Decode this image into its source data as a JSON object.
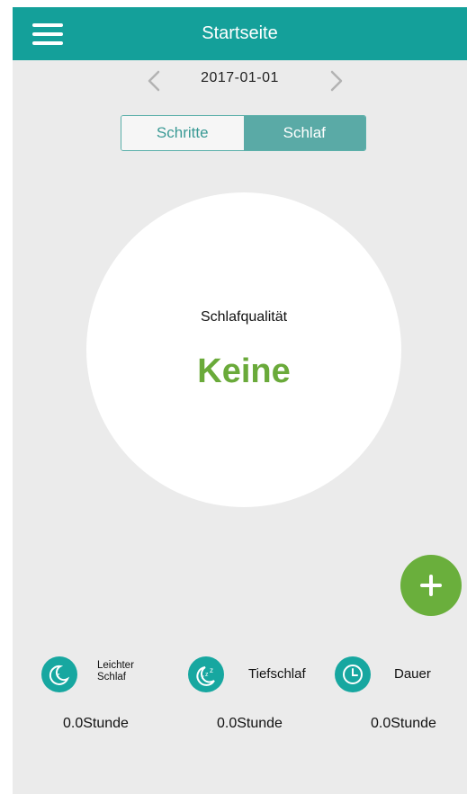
{
  "header": {
    "title": "Startseite",
    "menu_icon": "hamburger-menu-icon"
  },
  "date_nav": {
    "date": "2017-01-01",
    "prev_icon": "chevron-left-icon",
    "next_icon": "chevron-right-icon"
  },
  "mode_toggle": {
    "options": [
      "Schritte",
      "Schlaf"
    ],
    "selected": "Schlaf"
  },
  "sleep_quality": {
    "label": "Schlafqualität",
    "value": "Keine"
  },
  "add_button": {
    "icon": "plus-icon"
  },
  "stats": [
    {
      "label_line1": "Leichter",
      "label_line2": "Schlaf",
      "value": "0.0Stunde",
      "icon": "moon-icon"
    },
    {
      "label": "Tiefschlaf",
      "value": "0.0Stunde",
      "icon": "moon-zzz-icon"
    },
    {
      "label": "Dauer",
      "value": "0.0Stunde",
      "icon": "clock-icon"
    }
  ],
  "colors": {
    "header": "#14a09a",
    "accent_teal": "#17a7a0",
    "toggle_active": "#5aaaa6",
    "quality_green": "#6aaa3a",
    "fab_green": "#6aaf3c",
    "background": "#ebebeb"
  }
}
